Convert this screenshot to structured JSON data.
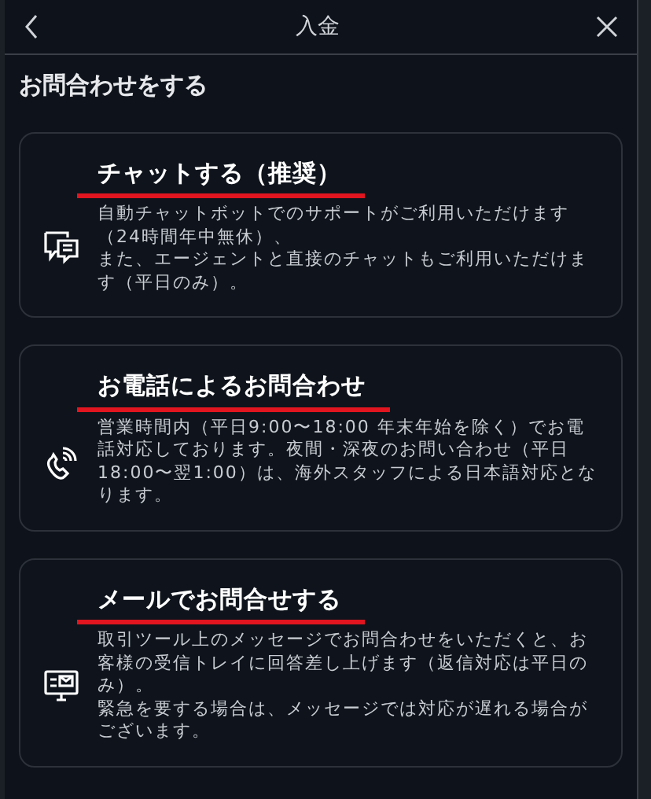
{
  "window": {
    "title": "入金"
  },
  "heading": "お問合わせをする",
  "options": [
    {
      "kind": "chat",
      "title": "チャットする（推奨）",
      "paragraphs": [
        "自動チャットボットでのサポートがご利用いただけます（24時間年中無休）、",
        "また、エージェントと直接のチャットもご利用いただけます（平日のみ）。"
      ]
    },
    {
      "kind": "phone",
      "title": "お電話によるお問合わせ",
      "paragraphs": [
        "営業時間内（平日9:00〜18:00 年末年始を除く）でお電話対応しております。夜間・深夜のお問い合わせ（平日18:00〜翌1:00）は、海外スタッフによる日本語対応となります。"
      ]
    },
    {
      "kind": "mail",
      "title": "メールでお問合せする",
      "paragraphs": [
        "取引ツール上のメッセージでお問合わせをいただくと、お客様の受信トレイに回答差し上げます（返信対応は平日のみ）。",
        "緊急を要する場合は、メッセージでは対応が遅れる場合がございます。"
      ]
    }
  ]
}
